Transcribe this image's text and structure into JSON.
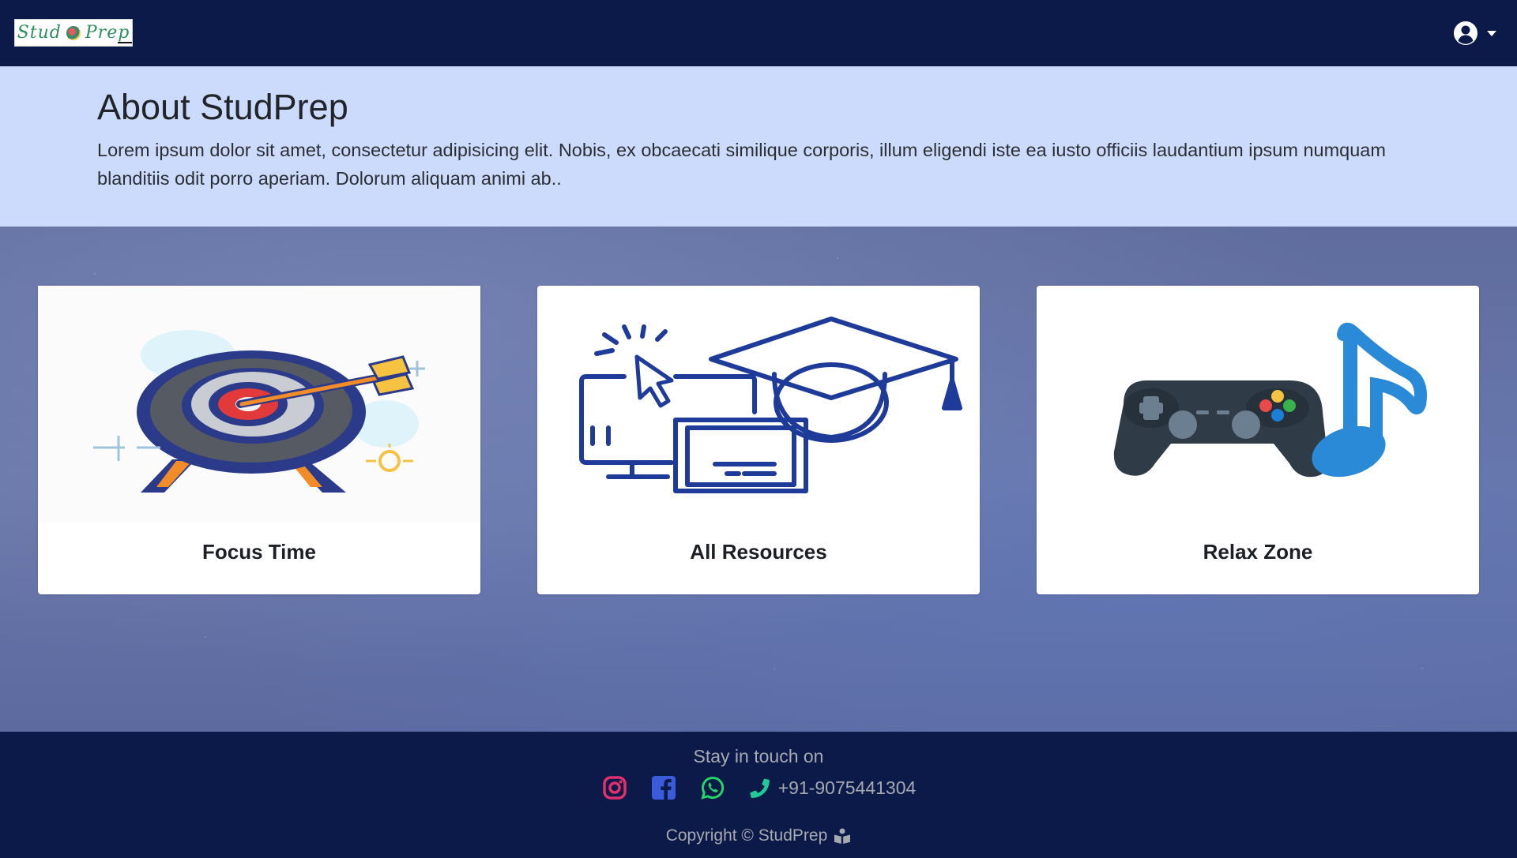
{
  "navbar": {
    "logo_text": "Stud Prep",
    "user_icon": "user-circle-icon",
    "caret_icon": "caret-down-icon"
  },
  "about": {
    "title": "About StudPrep",
    "body": "Lorem ipsum dolor sit amet, consectetur adipisicing elit. Nobis, ex obcaecati similique corporis, illum eligendi iste ea iusto officiis laudantium ipsum numquam blanditiis odit porro aperiam. Dolorum aliquam animi ab.."
  },
  "cards": [
    {
      "title": "Focus Time",
      "image": "target-arrow-icon"
    },
    {
      "title": "All Resources",
      "image": "graduation-computer-icon"
    },
    {
      "title": "Relax Zone",
      "image": "gamepad-music-icon"
    }
  ],
  "footer": {
    "stay_label": "Stay in touch on",
    "socials": [
      {
        "name": "instagram-icon",
        "color": "#e1306c"
      },
      {
        "name": "facebook-icon",
        "color": "#3b5bdb"
      },
      {
        "name": "whatsapp-icon",
        "color": "#25d366"
      }
    ],
    "phone_icon": "phone-icon",
    "phone_color": "#20c997",
    "phone_number": "+91-9075441304",
    "copyright": "Copyright © StudPrep"
  },
  "colors": {
    "navbar_bg": "#0b1a48",
    "about_bg": "#ccdafc",
    "footer_text": "#a6a9b0"
  }
}
